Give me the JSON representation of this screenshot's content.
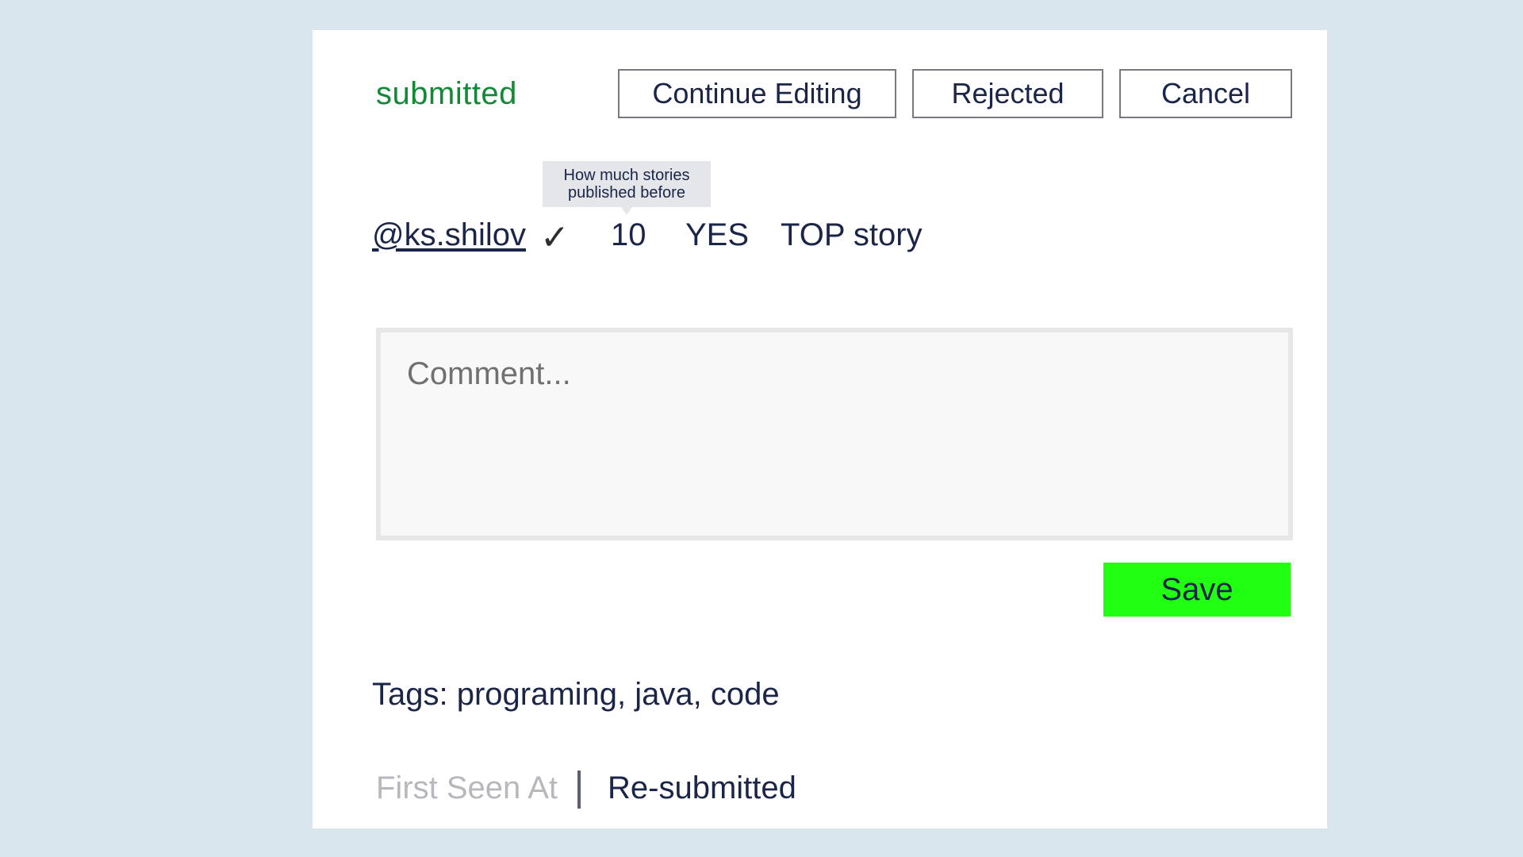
{
  "header": {
    "status": "submitted",
    "status_color": "#128a35",
    "buttons": {
      "continue_editing": "Continue Editing",
      "rejected": "Rejected",
      "cancel": "Cancel"
    }
  },
  "story": {
    "author": "@ks.shilov",
    "verified_icon": "check-icon",
    "tooltip": {
      "line1": "How much stories",
      "line2": "published before"
    },
    "published_count": "10",
    "flag": "YES",
    "label": "TOP story"
  },
  "comment": {
    "placeholder": "Comment...",
    "value": ""
  },
  "save": {
    "label": "Save",
    "color": "#21ff12"
  },
  "tags": {
    "text": "Tags: programing, java, code"
  },
  "footer": {
    "first_seen": "First Seen At",
    "resubmitted": "Re-submitted"
  }
}
